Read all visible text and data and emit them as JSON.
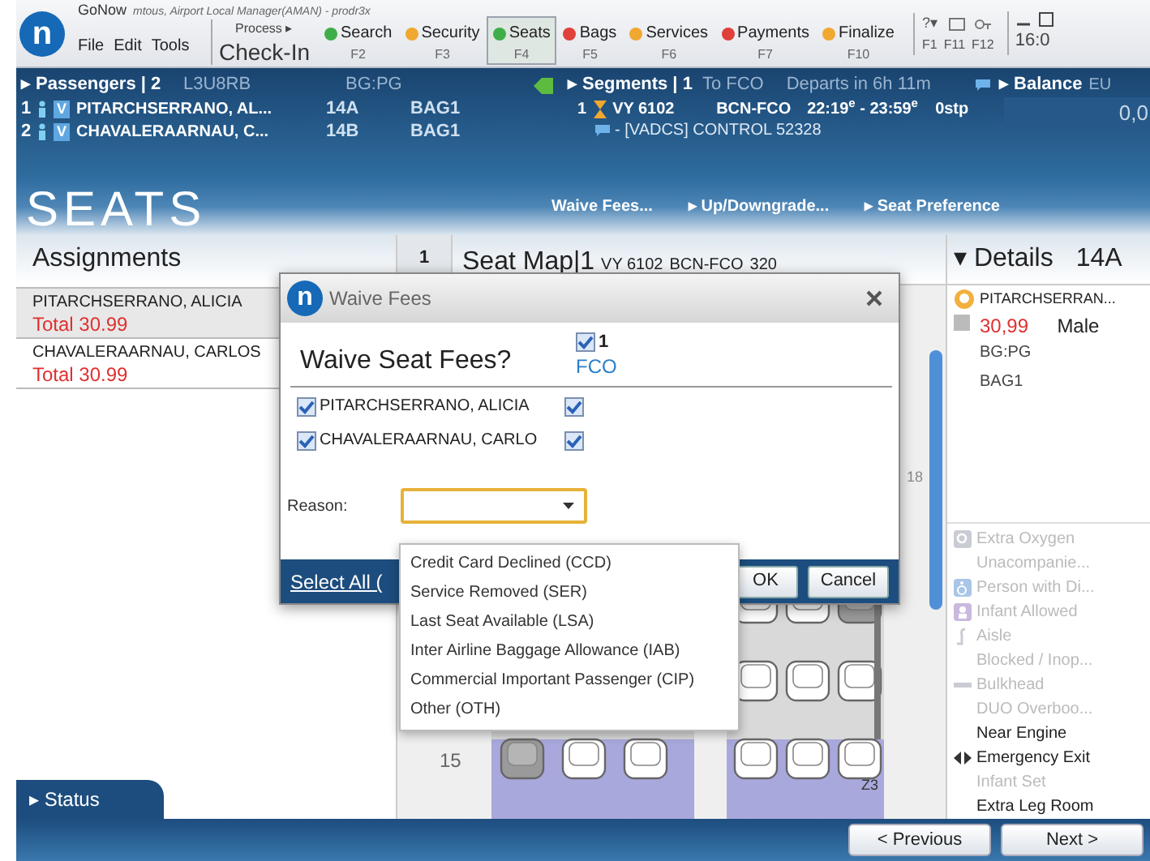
{
  "window": {
    "logo": "n",
    "app": "GoNow",
    "subtitle": "mtous, Airport Local Manager(AMAN) - prodr3x",
    "clock": "16:0"
  },
  "menu": [
    "File",
    "Edit",
    "Tools"
  ],
  "process": {
    "label": "Process ▸",
    "value": "Check-In"
  },
  "steps": [
    {
      "label": "Search",
      "key": "F2",
      "color": "#3fae49",
      "selected": false
    },
    {
      "label": "Security",
      "key": "F3",
      "color": "#f0a830",
      "selected": false
    },
    {
      "label": "Seats",
      "key": "F4",
      "color": "#3fae49",
      "selected": true
    },
    {
      "label": "Bags",
      "key": "F5",
      "color": "#e0403a",
      "selected": false
    },
    {
      "label": "Services",
      "key": "F6",
      "color": "#f0a830",
      "selected": false
    },
    {
      "label": "Payments",
      "key": "F7",
      "color": "#e0403a",
      "selected": false
    },
    {
      "label": "Finalize",
      "key": "F10",
      "color": "#f0a830",
      "selected": false
    }
  ],
  "help": {
    "label": "?▾",
    "keys": [
      "F1",
      "F11",
      "F12"
    ]
  },
  "passengers": {
    "title": "▸ Passengers | 2",
    "pnr": "L3U8RB",
    "group": "BG:PG",
    "rows": [
      {
        "index": "1",
        "badge": "V",
        "name": "PITARCHSERRANO, AL...",
        "seat": "14A",
        "bag": "BAG1"
      },
      {
        "index": "2",
        "badge": "V",
        "name": "CHAVALERAARNAU, C...",
        "seat": "14B",
        "bag": "BAG1"
      }
    ]
  },
  "segments": {
    "title": "▸ Segments | 1",
    "destination": "To FCO",
    "departs": "Departs in 6h 11m",
    "rows": [
      {
        "index": "1",
        "flight": "VY 6102",
        "route": "BCN-FCO",
        "times": "22:19$^{e}$ - 23:59$^{e}$",
        "stops": "0stp"
      }
    ],
    "remark": "- [VADCS] CONTROL 52328"
  },
  "balance": {
    "title": "▸ Balance",
    "currency": "EU",
    "amount": "0,0"
  },
  "section": {
    "title": "SEATS",
    "actions": [
      "Waive Fees...",
      "▸ Up/Downgrade...",
      "▸ Seat Preference"
    ]
  },
  "assignments": {
    "title": "Assignments",
    "items": [
      {
        "name": "PITARCHSERRANO, ALICIA",
        "total": "Total 30.99",
        "selected": true
      },
      {
        "name": "CHAVALERAARNAU, CARLOS",
        "total": "Total 30.99",
        "selected": false
      }
    ]
  },
  "seat_map": {
    "segment_tab": "1",
    "title": "Seat Map|1",
    "flight": "VY 6102",
    "route": "BCN-FCO",
    "aircraft": "320",
    "row_labels": [
      "18",
      "15"
    ],
    "zone": "Z3"
  },
  "details": {
    "title": "▾ Details",
    "seat": "14A",
    "name": "PITARCHSERRAN...",
    "price": "30,99",
    "gender": "Male",
    "group": "BG:PG",
    "bag": "BAG1",
    "legend": [
      {
        "label": "Extra Oxygen",
        "kind": "oxygen",
        "dimmed": true
      },
      {
        "label": "Unacompanie...",
        "kind": "plain",
        "dimmed": true
      },
      {
        "label": "Person with Di...",
        "kind": "wheelchair",
        "dimmed": true
      },
      {
        "label": "Infant Allowed",
        "kind": "infant",
        "dimmed": true
      },
      {
        "label": "Aisle",
        "kind": "aisle",
        "dimmed": true
      },
      {
        "label": "Blocked / Inop...",
        "kind": "plain",
        "dimmed": true
      },
      {
        "label": "Bulkhead",
        "kind": "bulkhead",
        "dimmed": true
      },
      {
        "label": "DUO Overboo...",
        "kind": "plain",
        "dimmed": true
      },
      {
        "label": "Near Engine",
        "kind": "plain",
        "dimmed": false
      },
      {
        "label": "Emergency Exit",
        "kind": "exit",
        "dimmed": false
      },
      {
        "label": "Infant Set",
        "kind": "plain",
        "dimmed": true
      },
      {
        "label": "Extra Leg Room",
        "kind": "plain",
        "dimmed": false
      }
    ]
  },
  "dialog": {
    "logo": "n",
    "title": "Waive Fees",
    "heading": "Waive Seat Fees?",
    "segment": {
      "number": "1",
      "code": "FCO",
      "checked": true
    },
    "passengers": [
      {
        "name": "PITARCHSERRANO, ALICIA",
        "checked": true,
        "segment_checked": true
      },
      {
        "name": "CHAVALERAARNAU, CARLO",
        "checked": true,
        "segment_checked": true
      }
    ],
    "reason_label": "Reason:",
    "select_all": "Select All (",
    "ok": "OK",
    "cancel": "Cancel"
  },
  "reason_options": [
    "Credit Card Declined (CCD)",
    "Service Removed (SER)",
    "Last Seat Available (LSA)",
    "Inter Airline Baggage Allowance (IAB)",
    "Commercial Important Passenger (CIP)",
    "Other (OTH)"
  ],
  "status_tab": "▸ Status",
  "nav": {
    "previous": "< Previous",
    "next": "Next >"
  }
}
